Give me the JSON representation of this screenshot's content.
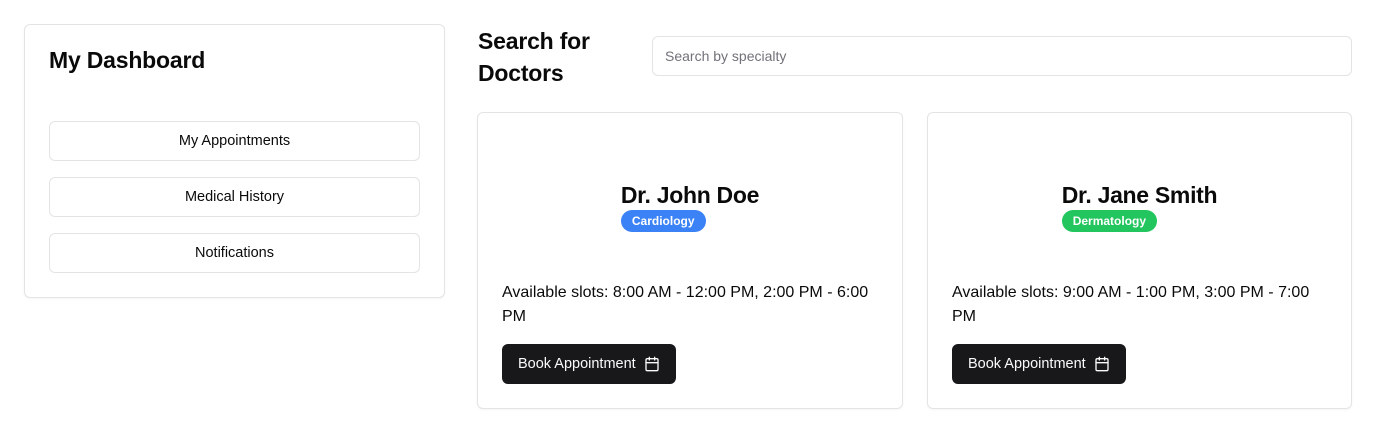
{
  "sidebar": {
    "title": "My Dashboard",
    "items": [
      {
        "label": "My Appointments"
      },
      {
        "label": "Medical History"
      },
      {
        "label": "Notifications"
      }
    ]
  },
  "main": {
    "title": "Search for Doctors",
    "search": {
      "value": "",
      "placeholder": "Search by specialty"
    }
  },
  "doctors": [
    {
      "name": "Dr. John Doe",
      "specialty": "Cardiology",
      "badge_color": "#3b82f6",
      "slots": "Available slots: 8:00 AM - 12:00 PM, 2:00 PM - 6:00 PM",
      "book_label": "Book Appointment",
      "book_icon": "calendar-icon"
    },
    {
      "name": "Dr. Jane Smith",
      "specialty": "Dermatology",
      "badge_color": "#22c55e",
      "slots": "Available slots: 9:00 AM - 1:00 PM, 3:00 PM - 7:00 PM",
      "book_label": "Book Appointment",
      "book_icon": "calendar-icon"
    }
  ],
  "theme": {
    "primary_button": "#18181b",
    "border": "#e4e4e7"
  }
}
